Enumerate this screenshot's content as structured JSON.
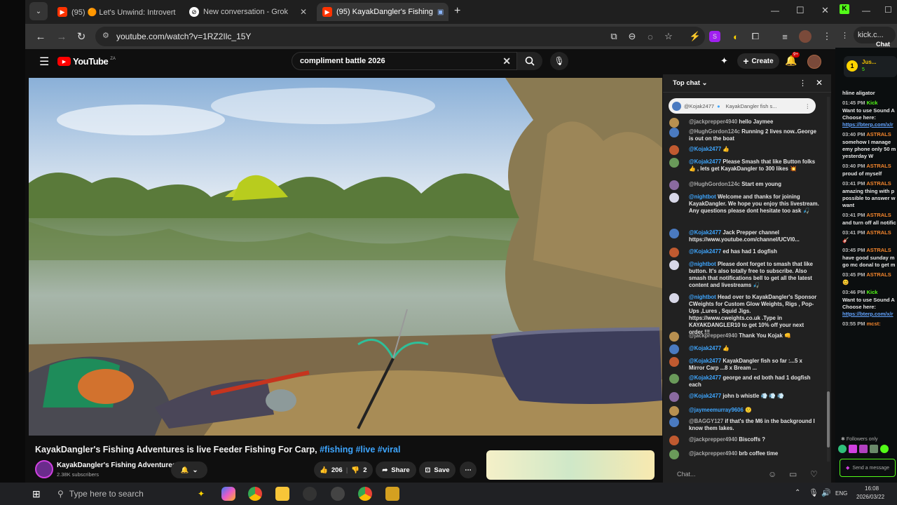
{
  "tabs": [
    {
      "label": "(95) 🟠 Let's Unwind: Introvert",
      "active": false
    },
    {
      "label": "New conversation - Grok",
      "active": false
    },
    {
      "label": "(95) KayakDangler's Fishing",
      "active": true
    }
  ],
  "address": {
    "url": "youtube.com/watch?v=1RZ2Ilc_15Y"
  },
  "youtube": {
    "logo": "YouTube",
    "region": "ZA",
    "search_value": "compliment battle 2026",
    "create_label": "Create",
    "notif_count": "9+"
  },
  "video": {
    "title_main": "KayakDangler's Fishing Adventures is live Feeder Fishing For Carp, ",
    "title_tags": "#fishing #live #viral",
    "channel": "KayakDangler's Fishing Adventures",
    "subscribers": "2.38K subscribers",
    "likes": "206",
    "dislikes": "2",
    "share_label": "Share",
    "save_label": "Save"
  },
  "chat": {
    "mode": "Top chat",
    "pinned_author": "@Kojak2477",
    "pinned_text": "KayakDangler fish s...",
    "input_placeholder": "Chat...",
    "messages": [
      {
        "author": "@jackprepper4940",
        "text": "hello Jaymee"
      },
      {
        "author": "@HughGordon124c",
        "text": "Running 2 lives now..George is out on the boat"
      },
      {
        "author": "@Kojak2477",
        "text": "👍"
      },
      {
        "author": "@Kojak2477",
        "text": "Please Smash that like Button folks 👍 , lets get KayakDangler to 300 likes 💥"
      },
      {
        "author": "@HughGordon124c",
        "text": "Start em young"
      },
      {
        "author": "@nightbot",
        "text": "Welcome and thanks for joining KayakDangler. We hope you enjoy this livestream. Any questions please dont hesitate too ask 🎣"
      },
      {
        "author": "@Kojak2477",
        "text": "Jack Prepper channel https://www.youtube.com/channel/UCVl0..."
      },
      {
        "author": "@Kojak2477",
        "text": "ed has had 1 dogfish"
      },
      {
        "author": "@nightbot",
        "text": "Please dont forget to smash that like button. It's also totally free to subscribe. Also smash that notifications bell to get all the latest content and livestreams 🎣"
      },
      {
        "author": "@nightbot",
        "text": "Head over to KayakDangler's Sponsor CWeights for Custom Glow Weights, Rigs , Pop-Ups ,Lures , Squid Jigs. https://www.cweights.co.uk .Type in KAYAKDANGLER10 to get 10% off your next order !!!"
      },
      {
        "author": "@jackprepper4940",
        "text": "Thank You Kojak 👊"
      },
      {
        "author": "@Kojak2477",
        "text": "👍"
      },
      {
        "author": "@Kojak2477",
        "text": "KayakDangler fish so far :...5 x Mirror Carp ...8 x Bream ..."
      },
      {
        "author": "@Kojak2477",
        "text": "george and ed both had 1 dogfish each"
      },
      {
        "author": "@Kojak2477",
        "text": "john b whistle 💨 💨 💨"
      },
      {
        "author": "@jaymeemurray9606",
        "text": "🙂"
      },
      {
        "author": "@BAGGY127",
        "text": "if that's the M6 in the background I know them lakes."
      },
      {
        "author": "@jackprepper4940",
        "text": "Biscoffs ?"
      },
      {
        "author": "@jackprepper4940",
        "text": "brb coffee time"
      }
    ]
  },
  "kick": {
    "tab_label": "kick.c...",
    "chat_title": "Chat",
    "pinned_user": "Jus...",
    "pinned_count": "5",
    "lines": [
      {
        "time": "",
        "user": "",
        "text": "hline aligator"
      },
      {
        "time": "01:45 PM",
        "user": "Kick",
        "text": "Want to use Sound A"
      },
      {
        "time": "",
        "user": "",
        "text": "Choose here:"
      },
      {
        "time": "",
        "user": "",
        "text": "https://bterp.com/x/r"
      },
      {
        "time": "03:40 PM",
        "user": "ASTRALS",
        "text": "somehow I manage"
      },
      {
        "time": "",
        "user": "",
        "text": "emy phone only 50 m"
      },
      {
        "time": "",
        "user": "",
        "text": "yesterday W"
      },
      {
        "time": "03:40 PM",
        "user": "ASTRALS",
        "text": "proud of myself"
      },
      {
        "time": "03:41 PM",
        "user": "ASTRALS",
        "text": "amazing thing with p"
      },
      {
        "time": "",
        "user": "",
        "text": "possible to answer w"
      },
      {
        "time": "",
        "user": "",
        "text": "want"
      },
      {
        "time": "03:41 PM",
        "user": "ASTRALS",
        "text": "and turn off all notific"
      },
      {
        "time": "03:41 PM",
        "user": "ASTRALS",
        "text": "🎸"
      },
      {
        "time": "03:45 PM",
        "user": "ASTRALS",
        "text": "have good sunday m"
      },
      {
        "time": "",
        "user": "",
        "text": "go mc donal to get m"
      },
      {
        "time": "03:45 PM",
        "user": "ASTRALS",
        "text": "😊"
      },
      {
        "time": "03:46 PM",
        "user": "Kick",
        "text": "Want to use Sound A"
      },
      {
        "time": "",
        "user": "",
        "text": "Choose here:"
      },
      {
        "time": "",
        "user": "",
        "text": "https://bterp.com/x/r"
      },
      {
        "time": "03:55 PM",
        "user": "mcst:",
        "text": ""
      }
    ],
    "followers_only": "Followers only",
    "send_label": "Send a message"
  },
  "taskbar": {
    "search_placeholder": "Type here to search",
    "lang": "ENG",
    "time": "16:08",
    "date": "2026/03/22"
  },
  "colors": {
    "yt_red": "#ff0000",
    "link_blue": "#3ea6ff",
    "kick_green": "#53fc18",
    "kick_orange": "#f5862c"
  }
}
